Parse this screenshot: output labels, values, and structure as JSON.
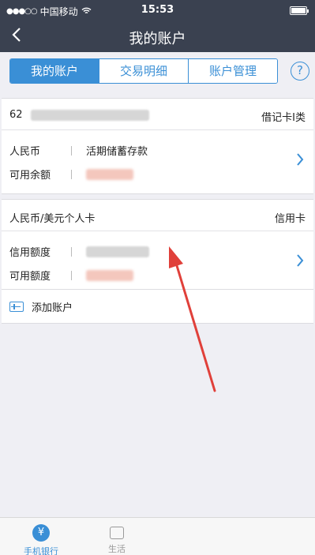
{
  "status_bar": {
    "signal_dots": "●●●○○",
    "carrier": "中国移动",
    "wifi_icon": "wifi-icon",
    "time": "15:53"
  },
  "nav": {
    "back_icon": "chevron-left-icon",
    "title": "我的账户"
  },
  "tabs": [
    {
      "label": "我的账户",
      "active": true
    },
    {
      "label": "交易明细",
      "active": false
    },
    {
      "label": "账户管理",
      "active": false
    }
  ],
  "help_label": "?",
  "accounts": [
    {
      "number": "62",
      "type": "借记卡I类",
      "rows": [
        {
          "label": "人民币",
          "value": "活期储蓄存款"
        },
        {
          "label": "可用余额",
          "value": ""
        }
      ]
    },
    {
      "name": "人民币/美元个人卡",
      "type": "信用卡",
      "rows": [
        {
          "label": "信用额度",
          "value": ""
        },
        {
          "label": "可用额度",
          "value": ""
        }
      ]
    }
  ],
  "add_account": {
    "label": "添加账户"
  },
  "bottom_tabs": [
    {
      "label": "手机银行",
      "icon_glyph": "¥",
      "active": true
    },
    {
      "label": "生活",
      "active": false
    }
  ],
  "colors": {
    "accent": "#3a8fd6",
    "navbar": "#3a4150",
    "arrow": "#e0403a"
  }
}
